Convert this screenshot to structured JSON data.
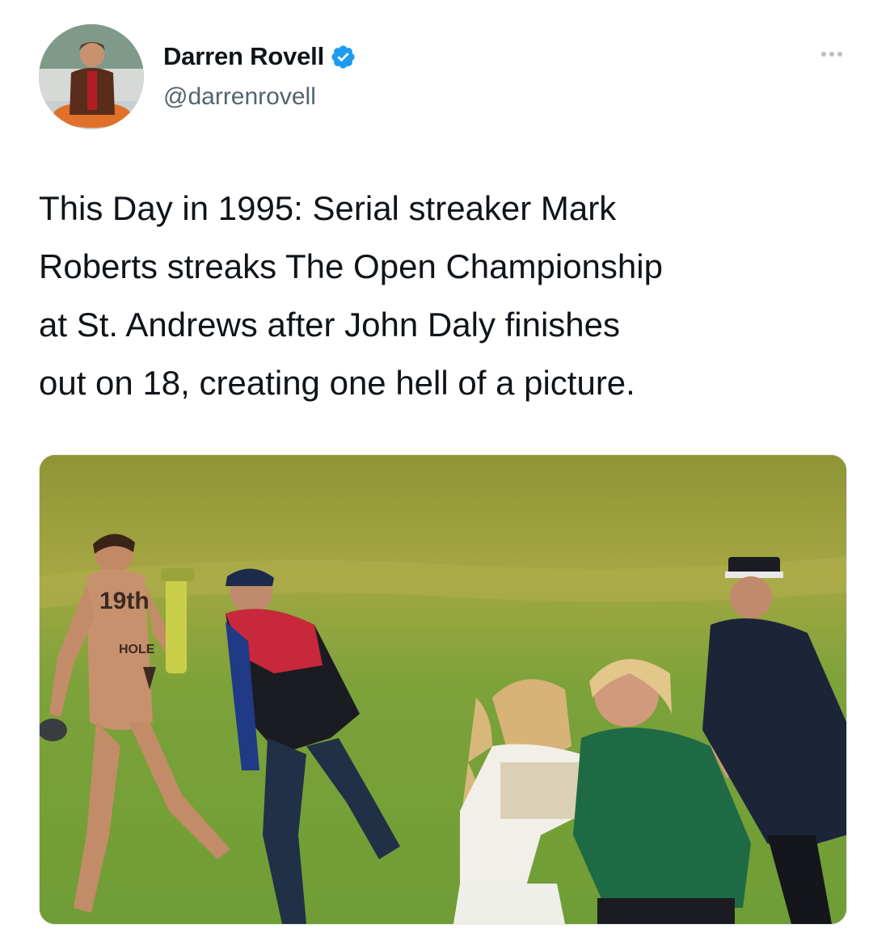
{
  "author": {
    "display_name": "Darren Rovell",
    "handle": "@darrenrovell",
    "verified": true,
    "avatar_icon": "profile-photo"
  },
  "more_icon": "ellipsis-icon",
  "tweet": {
    "lines": [
      "This Day in 1995: Serial streaker Mark",
      "Roberts streaks The Open Championship",
      "at St. Andrews after John Daly finishes",
      "out on 18, creating one hell of a picture."
    ]
  },
  "media": {
    "body_writing": [
      "19th",
      "HOLE"
    ]
  },
  "colors": {
    "verified_blue": "#1d9bf0",
    "text_primary": "#0f1419",
    "text_secondary": "#536471"
  }
}
